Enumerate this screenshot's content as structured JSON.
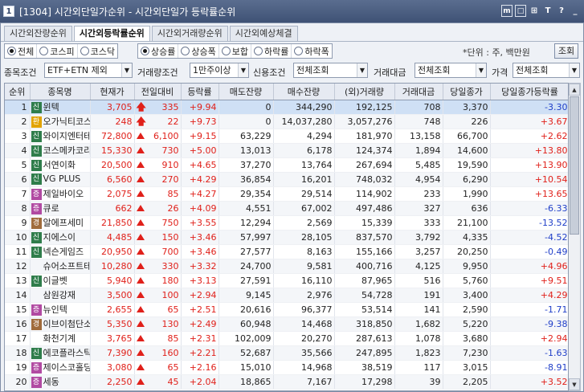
{
  "window": {
    "number": "1",
    "title": "[1304] 시간외단일가순위 - 시간외단일가 등락률순위",
    "icons": [
      "m",
      "□",
      "⊞",
      "T",
      "?",
      "_"
    ]
  },
  "tabs": [
    "시간외잔량순위",
    "시간외등락률순위",
    "시간외거래량순위",
    "시간외예상체결"
  ],
  "market_options": [
    "전체",
    "코스피",
    "코스닥"
  ],
  "direction_options": [
    "상승률",
    "상승폭",
    "보합",
    "하락률",
    "하락폭"
  ],
  "unit_text": "*단위 : 주, 백만원",
  "search_label": "조회",
  "filters": {
    "stock_cond_label": "종목조건",
    "stock_cond_value": "ETF+ETN 제외",
    "vol_cond_label": "거래량조건",
    "vol_cond_value": "1만주이상",
    "credit_cond_label": "신용조건",
    "credit_cond_value": "전체조회",
    "amount_label": "거래대금",
    "amount_value": "전체조회",
    "price_label": "가격",
    "price_value": "전체조회"
  },
  "colors": {
    "up": "#e0201a",
    "down": "#1f3ec8",
    "badge_신": "#2f7d4b",
    "badge_증": "#b14aa2",
    "badge_환": "#e2a300",
    "badge_경": "#a06b3b"
  },
  "table": {
    "headers": [
      "순위",
      "종목명",
      "현재가",
      "전일대비",
      "등락률",
      "매도잔량",
      "매수잔량",
      "(외)거래량",
      "거래대금",
      "당일종가",
      "당일종가등락률"
    ],
    "rows": [
      {
        "rank": "1",
        "badge": "신",
        "name": "윈텍",
        "price": "3,705",
        "mark": "arrow",
        "diff": "335",
        "rate": "+9.94",
        "ask": "0",
        "bid": "344,290",
        "volume": "192,125",
        "amount": "708",
        "close": "3,370",
        "close_rate": "-3.30",
        "cr_dir": "down"
      },
      {
        "rank": "2",
        "badge": "환",
        "name": "오가닉티코스",
        "price": "248",
        "mark": "arrow",
        "diff": "22",
        "rate": "+9.73",
        "ask": "0",
        "bid": "14,037,280",
        "volume": "3,057,276",
        "amount": "748",
        "close": "226",
        "close_rate": "+3.67",
        "cr_dir": "up"
      },
      {
        "rank": "3",
        "badge": "신",
        "name": "와이지엔터테",
        "price": "72,800",
        "mark": "tri",
        "diff": "6,100",
        "rate": "+9.15",
        "ask": "63,229",
        "bid": "4,294",
        "volume": "181,970",
        "amount": "13,158",
        "close": "66,700",
        "close_rate": "+2.62",
        "cr_dir": "up"
      },
      {
        "rank": "4",
        "badge": "신",
        "name": "코스메카코리",
        "price": "15,330",
        "mark": "tri",
        "diff": "730",
        "rate": "+5.00",
        "ask": "13,013",
        "bid": "6,178",
        "volume": "124,374",
        "amount": "1,894",
        "close": "14,600",
        "close_rate": "+13.80",
        "cr_dir": "up"
      },
      {
        "rank": "5",
        "badge": "신",
        "name": "서연이화",
        "price": "20,500",
        "mark": "tri",
        "diff": "910",
        "rate": "+4.65",
        "ask": "37,270",
        "bid": "13,764",
        "volume": "267,694",
        "amount": "5,485",
        "close": "19,590",
        "close_rate": "+13.90",
        "cr_dir": "up"
      },
      {
        "rank": "6",
        "badge": "신",
        "name": "VG PLUS",
        "price": "6,560",
        "mark": "tri",
        "diff": "270",
        "rate": "+4.29",
        "ask": "36,854",
        "bid": "16,201",
        "volume": "748,032",
        "amount": "4,954",
        "close": "6,290",
        "close_rate": "+10.54",
        "cr_dir": "up"
      },
      {
        "rank": "7",
        "badge": "증",
        "name": "제일바이오",
        "price": "2,075",
        "mark": "tri",
        "diff": "85",
        "rate": "+4.27",
        "ask": "29,354",
        "bid": "29,514",
        "volume": "114,902",
        "amount": "233",
        "close": "1,990",
        "close_rate": "+13.65",
        "cr_dir": "up"
      },
      {
        "rank": "8",
        "badge": "증",
        "name": "큐로",
        "price": "662",
        "mark": "tri",
        "diff": "26",
        "rate": "+4.09",
        "ask": "4,551",
        "bid": "67,002",
        "volume": "497,486",
        "amount": "327",
        "close": "636",
        "close_rate": "-6.33",
        "cr_dir": "down"
      },
      {
        "rank": "9",
        "badge": "경",
        "name": "알에프세미",
        "price": "21,850",
        "mark": "tri",
        "diff": "750",
        "rate": "+3.55",
        "ask": "12,294",
        "bid": "2,569",
        "volume": "15,339",
        "amount": "333",
        "close": "21,100",
        "close_rate": "-13.52",
        "cr_dir": "down"
      },
      {
        "rank": "10",
        "badge": "신",
        "name": "지에스이",
        "price": "4,485",
        "mark": "tri",
        "diff": "150",
        "rate": "+3.46",
        "ask": "57,997",
        "bid": "28,105",
        "volume": "837,570",
        "amount": "3,792",
        "close": "4,335",
        "close_rate": "-4.52",
        "cr_dir": "down"
      },
      {
        "rank": "11",
        "badge": "신",
        "name": "넥슨게임즈",
        "price": "20,950",
        "mark": "tri",
        "diff": "700",
        "rate": "+3.46",
        "ask": "27,577",
        "bid": "8,163",
        "volume": "155,166",
        "amount": "3,257",
        "close": "20,250",
        "close_rate": "-0.49",
        "cr_dir": "down"
      },
      {
        "rank": "12",
        "badge": "",
        "name": "슈어소프트테",
        "price": "10,280",
        "mark": "tri",
        "diff": "330",
        "rate": "+3.32",
        "ask": "24,700",
        "bid": "9,581",
        "volume": "400,716",
        "amount": "4,125",
        "close": "9,950",
        "close_rate": "+4.96",
        "cr_dir": "up"
      },
      {
        "rank": "13",
        "badge": "신",
        "name": "이글벳",
        "price": "5,940",
        "mark": "tri",
        "diff": "180",
        "rate": "+3.13",
        "ask": "27,591",
        "bid": "16,110",
        "volume": "87,965",
        "amount": "516",
        "close": "5,760",
        "close_rate": "+9.51",
        "cr_dir": "up"
      },
      {
        "rank": "14",
        "badge": "",
        "name": "삼원강재",
        "price": "3,500",
        "mark": "tri",
        "diff": "100",
        "rate": "+2.94",
        "ask": "9,145",
        "bid": "2,976",
        "volume": "54,728",
        "amount": "191",
        "close": "3,400",
        "close_rate": "+4.29",
        "cr_dir": "up"
      },
      {
        "rank": "15",
        "badge": "증",
        "name": "뉴인텍",
        "price": "2,655",
        "mark": "tri",
        "diff": "65",
        "rate": "+2.51",
        "ask": "20,616",
        "bid": "96,377",
        "volume": "53,514",
        "amount": "141",
        "close": "2,590",
        "close_rate": "-1.71",
        "cr_dir": "down"
      },
      {
        "rank": "16",
        "badge": "경",
        "name": "이브이첨단소",
        "price": "5,350",
        "mark": "tri",
        "diff": "130",
        "rate": "+2.49",
        "ask": "60,948",
        "bid": "14,468",
        "volume": "318,850",
        "amount": "1,682",
        "close": "5,220",
        "close_rate": "-9.38",
        "cr_dir": "down"
      },
      {
        "rank": "17",
        "badge": "",
        "name": "화천기계",
        "price": "3,765",
        "mark": "tri",
        "diff": "85",
        "rate": "+2.31",
        "ask": "102,009",
        "bid": "20,270",
        "volume": "287,613",
        "amount": "1,078",
        "close": "3,680",
        "close_rate": "+2.94",
        "cr_dir": "up"
      },
      {
        "rank": "18",
        "badge": "신",
        "name": "에코플라스틱",
        "price": "7,390",
        "mark": "tri",
        "diff": "160",
        "rate": "+2.21",
        "ask": "52,687",
        "bid": "35,566",
        "volume": "247,895",
        "amount": "1,823",
        "close": "7,230",
        "close_rate": "-1.63",
        "cr_dir": "down"
      },
      {
        "rank": "19",
        "badge": "증",
        "name": "제이스코홀딩",
        "price": "3,080",
        "mark": "tri",
        "diff": "65",
        "rate": "+2.16",
        "ask": "15,010",
        "bid": "14,968",
        "volume": "38,519",
        "amount": "117",
        "close": "3,015",
        "close_rate": "-8.91",
        "cr_dir": "down"
      },
      {
        "rank": "20",
        "badge": "증",
        "name": "세동",
        "price": "2,250",
        "mark": "tri",
        "diff": "45",
        "rate": "+2.04",
        "ask": "18,865",
        "bid": "7,167",
        "volume": "17,298",
        "amount": "39",
        "close": "2,205",
        "close_rate": "+3.52",
        "cr_dir": "up"
      }
    ]
  }
}
